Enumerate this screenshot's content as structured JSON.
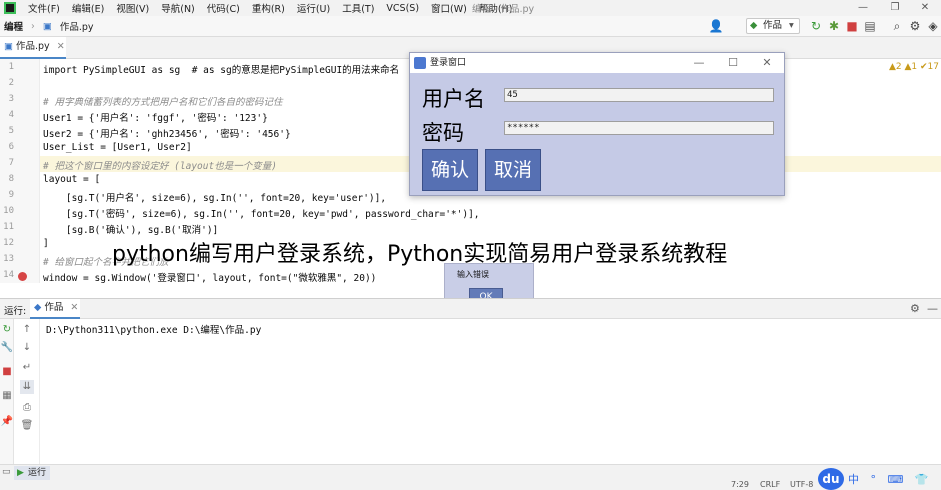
{
  "window": {
    "title": "编程 - 作品.py"
  },
  "menu": [
    "文件(F)",
    "编辑(E)",
    "视图(V)",
    "导航(N)",
    "代码(C)",
    "重构(R)",
    "运行(U)",
    "工具(T)",
    "VCS(S)",
    "窗口(W)",
    "帮助(H)"
  ],
  "breadcrumb": {
    "project": "编程",
    "file": "作品.py"
  },
  "run_config": "作品",
  "editor_tab": "作品.py",
  "inspections": "▲2  ▲1  ✔17",
  "line_numbers": [
    "1",
    "2",
    "3",
    "4",
    "5",
    "6",
    "7",
    "8",
    "9",
    "10",
    "11",
    "12",
    "13",
    "14"
  ],
  "code_lines": [
    "import PySimpleGUI as sg  # as sg的意思是把PySimpleGUI的用法来命名",
    "",
    "# 用字典储蓄列表的方式把用户名和它们各自的密码记住",
    "User1 = {'用户名': 'fggf', '密码': '123'}",
    "User2 = {'用户名': 'ghh23456', '密码': '456'}",
    "User_List = [User1, User2]",
    "# 把这个窗口里的内容设定好 (layout也是一个变量)",
    "layout = [",
    "    [sg.T('用户名', size=6), sg.In('', font=20, key='user')],",
    "    [sg.T('密码', size=6), sg.In('', font=20, key='pwd', password_char='*')],",
    "    [sg.B('确认'), sg.B('取消')]",
    "]",
    "# 给窗口起个名字并把它们放",
    "window = sg.Window('登录窗口', layout, font=(\"微软雅黑\", 20))"
  ],
  "login_dialog": {
    "title": "登录窗口",
    "username_label": "用户名",
    "username_value": "45",
    "password_label": "密码",
    "password_value": "******",
    "confirm_label": "确认",
    "cancel_label": "取消"
  },
  "caption": "python编写用户登录系统，Python实现简易用户登录系统教程",
  "popup": {
    "message": "输入错误",
    "ok_label": "OK"
  },
  "run_panel": {
    "label": "运行:",
    "tab": "作品",
    "output": "D:\\Python311\\python.exe D:\\编程\\作品.py"
  },
  "bottom_tool": "运行",
  "status": {
    "position": "7:29",
    "line_sep": "CRLF",
    "encoding": "UTF-8"
  },
  "watermark": {
    "logo": "du",
    "glyphs": "中 ° ⌨ 👕 ⊞"
  },
  "colors": {
    "dialog_bg": "#c5cae6",
    "dialog_button": "#5670b3",
    "accent": "#4a86c7"
  }
}
